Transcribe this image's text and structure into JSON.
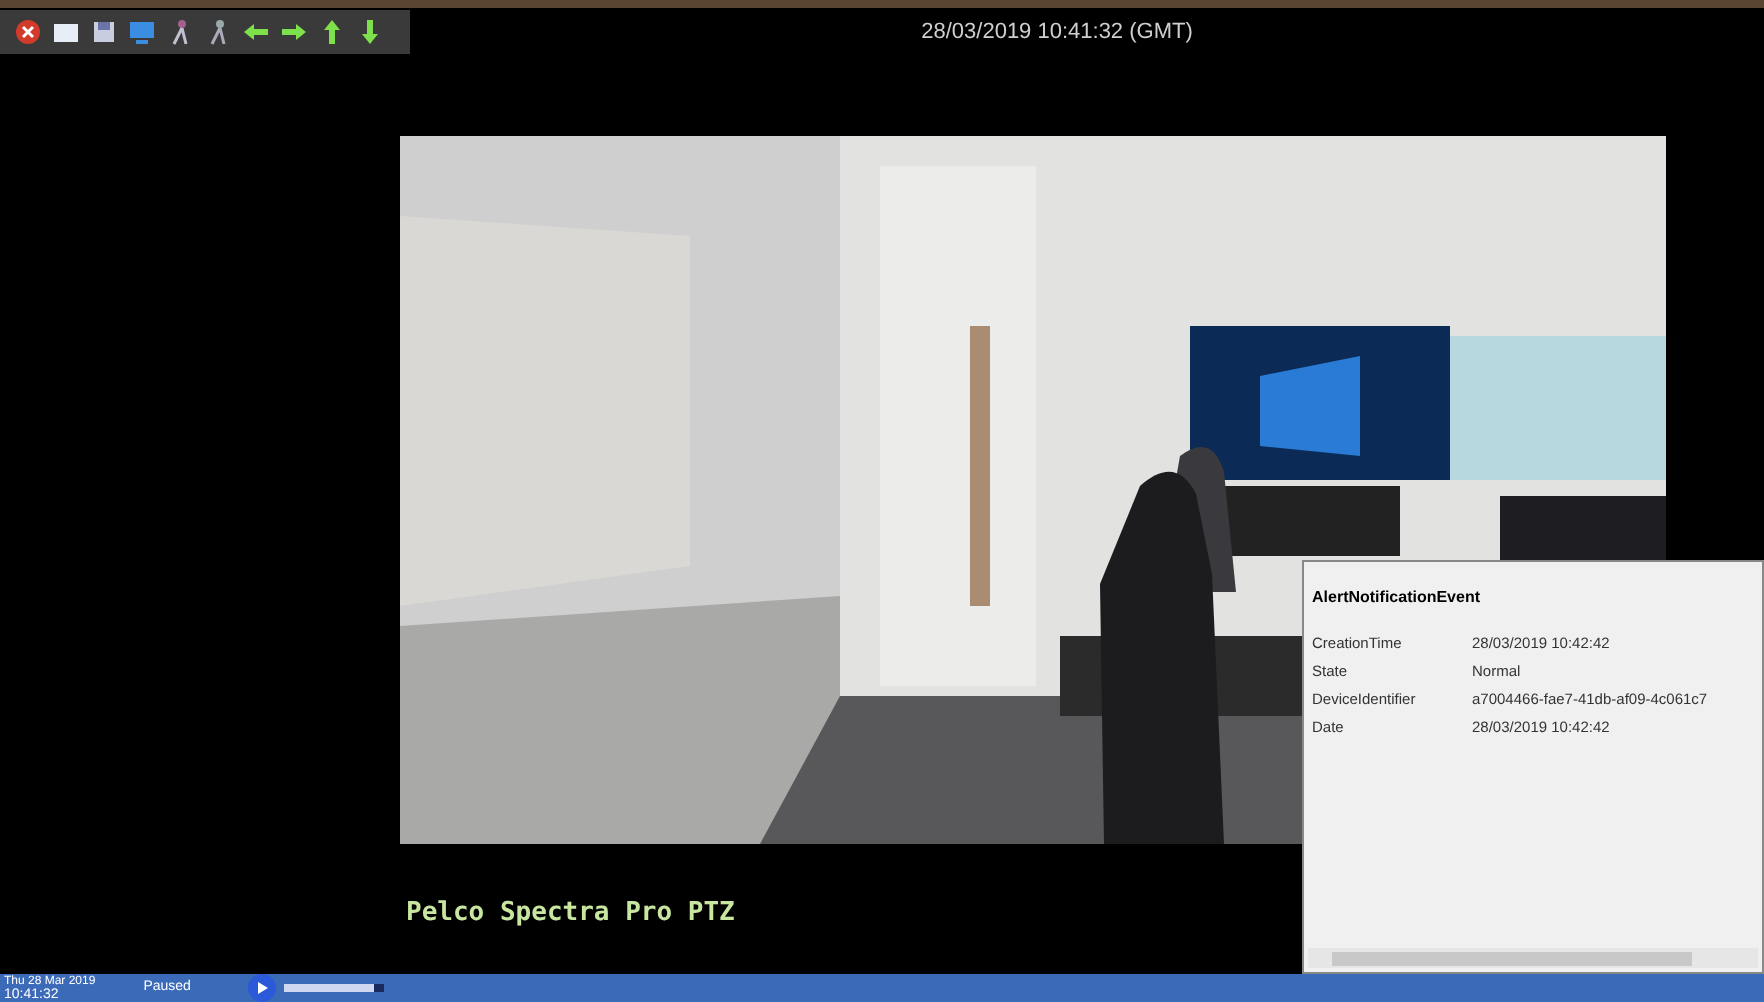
{
  "timestamp": "28/03/2019 10:41:32 (GMT)",
  "camera_name": "Pelco Spectra Pro PTZ",
  "alert": {
    "title": "AlertNotificationEvent",
    "fields": [
      {
        "label": "CreationTime",
        "value": "28/03/2019 10:42:42"
      },
      {
        "label": "State",
        "value": "Normal"
      },
      {
        "label": "DeviceIdentifier",
        "value": "a7004466-fae7-41db-af09-4c061c7"
      },
      {
        "label": "Date",
        "value": "28/03/2019 10:42:42"
      }
    ]
  },
  "status": {
    "date": "Thu 28 Mar 2019",
    "time": "10:41:32",
    "mode": "Paused",
    "speed": {
      "level": 0.9
    }
  }
}
